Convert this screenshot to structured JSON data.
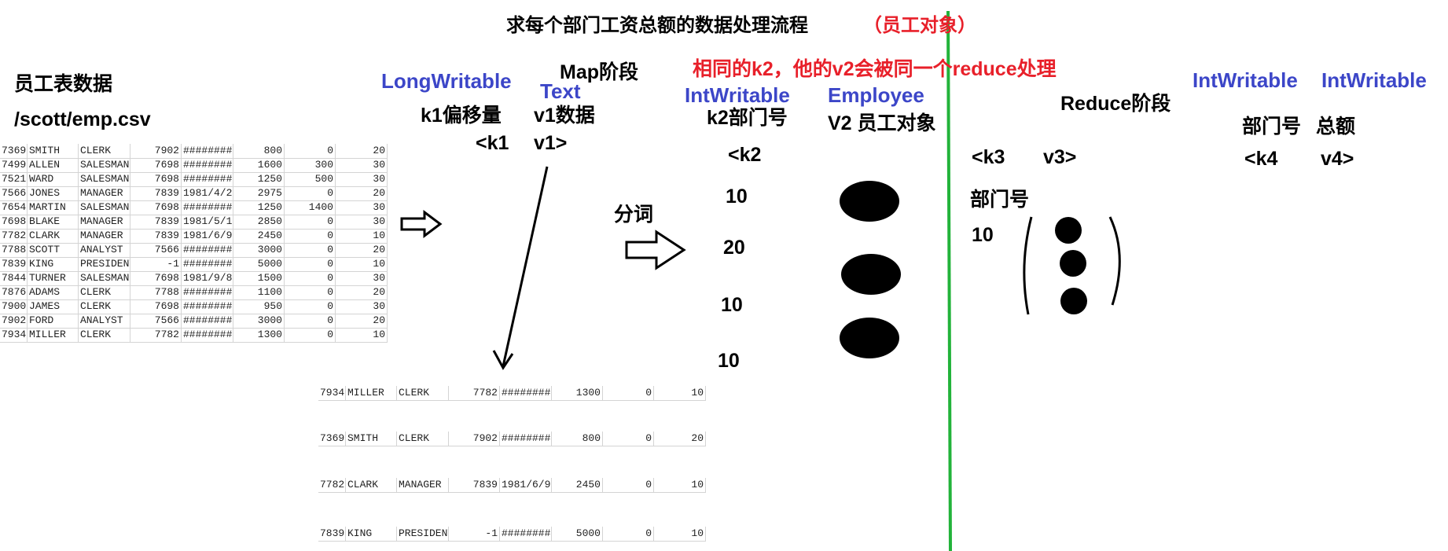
{
  "title": "求每个部门工资总额的数据处理流程",
  "title_note": "（员工对象）",
  "source": {
    "label": "员工表数据",
    "path": "/scott/emp.csv"
  },
  "emp_table": [
    [
      "7369",
      "SMITH",
      "CLERK",
      "7902",
      "########",
      "800",
      "0",
      "20"
    ],
    [
      "7499",
      "ALLEN",
      "SALESMAN",
      "7698",
      "########",
      "1600",
      "300",
      "30"
    ],
    [
      "7521",
      "WARD",
      "SALESMAN",
      "7698",
      "########",
      "1250",
      "500",
      "30"
    ],
    [
      "7566",
      "JONES",
      "MANAGER",
      "7839",
      "1981/4/2",
      "2975",
      "0",
      "20"
    ],
    [
      "7654",
      "MARTIN",
      "SALESMAN",
      "7698",
      "########",
      "1250",
      "1400",
      "30"
    ],
    [
      "7698",
      "BLAKE",
      "MANAGER",
      "7839",
      "1981/5/1",
      "2850",
      "0",
      "30"
    ],
    [
      "7782",
      "CLARK",
      "MANAGER",
      "7839",
      "1981/6/9",
      "2450",
      "0",
      "10"
    ],
    [
      "7788",
      "SCOTT",
      "ANALYST",
      "7566",
      "########",
      "3000",
      "0",
      "20"
    ],
    [
      "7839",
      "KING",
      "PRESIDENT",
      "-1",
      "########",
      "5000",
      "0",
      "10"
    ],
    [
      "7844",
      "TURNER",
      "SALESMAN",
      "7698",
      "1981/9/8",
      "1500",
      "0",
      "30"
    ],
    [
      "7876",
      "ADAMS",
      "CLERK",
      "7788",
      "########",
      "1100",
      "0",
      "20"
    ],
    [
      "7900",
      "JAMES",
      "CLERK",
      "7698",
      "########",
      "950",
      "0",
      "30"
    ],
    [
      "7902",
      "FORD",
      "ANALYST",
      "7566",
      "########",
      "3000",
      "0",
      "20"
    ],
    [
      "7934",
      "MILLER",
      "CLERK",
      "7782",
      "########",
      "1300",
      "0",
      "10"
    ]
  ],
  "split_rows": [
    [
      "7934",
      "MILLER",
      "CLERK",
      "7782",
      "########",
      "1300",
      "0",
      "10"
    ],
    [
      "7369",
      "SMITH",
      "CLERK",
      "7902",
      "########",
      "800",
      "0",
      "20"
    ],
    [
      "7782",
      "CLARK",
      "MANAGER",
      "7839",
      "1981/6/9",
      "2450",
      "0",
      "10"
    ],
    [
      "7839",
      "KING",
      "PRESIDENT",
      "-1",
      "########",
      "5000",
      "0",
      "10"
    ]
  ],
  "map": {
    "stage": "Map阶段",
    "k1_type": "LongWritable",
    "v1_type": "Text",
    "k1_desc": "k1偏移量",
    "v1_desc": "v1数据",
    "k1": "<k1",
    "v1": "v1>",
    "split_label": "分词",
    "k2_type": "IntWritable",
    "v2_type": "Employee",
    "k2_desc": "k2部门号",
    "v2_desc": "V2 员工对象",
    "k2": "<k2",
    "k2_values": [
      "10",
      "20",
      "10",
      "10"
    ]
  },
  "shuffle_note": "相同的k2，他的v2会被同一个reduce处理",
  "reduce": {
    "stage": "Reduce阶段",
    "k3": "<k3",
    "v3": "v3>",
    "k3_desc": "部门号",
    "k3_value": "10",
    "k4_type": "IntWritable",
    "v4_type": "IntWritable",
    "k4_desc": "部门号",
    "v4_desc": "总额",
    "k4": "<k4",
    "v4": "v4>"
  },
  "colors": {
    "type_blue": "#3c46c8",
    "note_red": "#e8202a",
    "divider_green": "#22b33a"
  }
}
